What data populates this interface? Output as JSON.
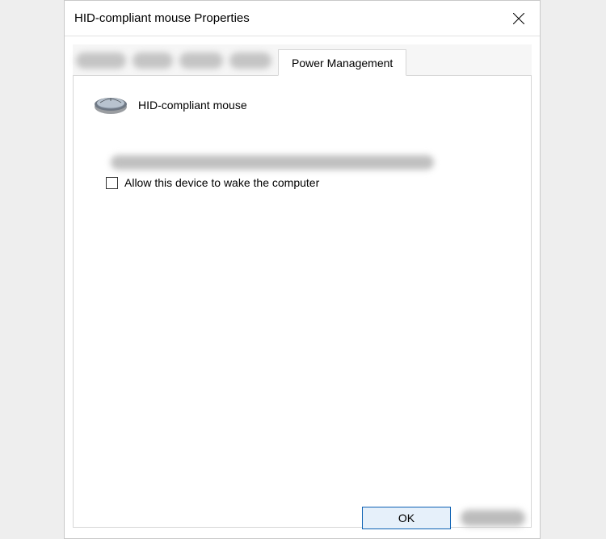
{
  "window": {
    "title": "HID-compliant mouse Properties"
  },
  "tabs": {
    "active": "Power Management"
  },
  "device": {
    "name": "HID-compliant mouse"
  },
  "options": {
    "wake_label": "Allow this device to wake the computer",
    "wake_checked": false
  },
  "buttons": {
    "ok": "OK"
  }
}
